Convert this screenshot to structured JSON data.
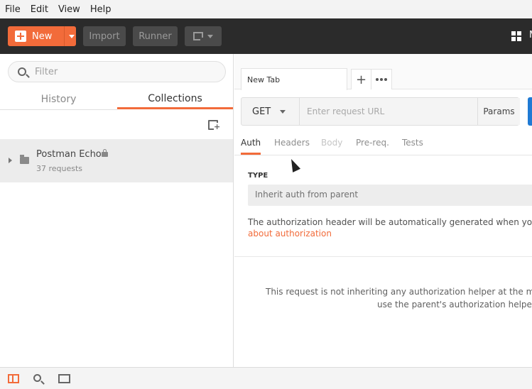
{
  "menu": [
    "File",
    "Edit",
    "View",
    "Help"
  ],
  "toolbar": {
    "new_label": "New",
    "import_label": "Import",
    "runner_label": "Runner",
    "trailing_letter": "M"
  },
  "sidebar": {
    "filter_placeholder": "Filter",
    "tabs": [
      {
        "label": "History",
        "active": false
      },
      {
        "label": "Collections",
        "active": true
      }
    ],
    "collections": [
      {
        "name": "Postman Echo",
        "count": "37 requests",
        "locked": true
      }
    ]
  },
  "main": {
    "tab_title": "New Tab",
    "method": "GET",
    "url_placeholder": "Enter request URL",
    "params_label": "Params",
    "subtabs": [
      {
        "label": "Auth",
        "state": "active"
      },
      {
        "label": "Headers",
        "state": "normal"
      },
      {
        "label": "Body",
        "state": "disabled"
      },
      {
        "label": "Pre-req.",
        "state": "normal"
      },
      {
        "label": "Tests",
        "state": "normal"
      }
    ],
    "type_label": "TYPE",
    "type_value": "Inherit auth from parent",
    "auth_description": "The authorization header will be automatically generated when you sen",
    "auth_link": "about authorization",
    "note_line1": "This request is not inheriting any authorization helper at the mome",
    "note_line2": "use the parent's authorization helper."
  },
  "colors": {
    "accent": "#f26b3a",
    "toolbar_bg": "#2b2b2b",
    "send_blue": "#1f7ad4"
  },
  "icons": {
    "new": "plus-icon",
    "filter": "search-icon",
    "new_collection": "new-collection-icon",
    "collection": "folder-icon",
    "lock": "lock-icon",
    "apps": "grid-icon",
    "sidebar_toggle": "sidebar-toggle-icon",
    "find": "find-icon",
    "console": "console-icon"
  }
}
